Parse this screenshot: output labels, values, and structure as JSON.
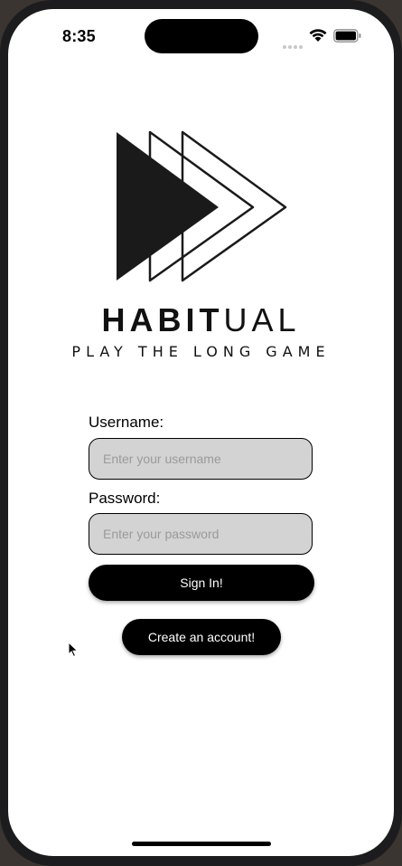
{
  "status_bar": {
    "time": "8:35",
    "icons": [
      "signal-icon",
      "wifi-icon",
      "battery-icon"
    ]
  },
  "branding": {
    "logo_icon": "fast-forward-triangles-icon",
    "name_bold": "HABIT",
    "name_light": "UAL",
    "tagline": "PLAY THE LONG GAME"
  },
  "login_form": {
    "username_label": "Username:",
    "username_placeholder": "Enter your username",
    "username_value": "",
    "password_label": "Password:",
    "password_placeholder": "Enter your password",
    "password_value": "",
    "sign_in_label": "Sign In!",
    "create_account_label": "Create an account!"
  },
  "colors": {
    "field_background": "#d3d3d3",
    "button_background": "#000000",
    "button_text": "#ffffff"
  }
}
